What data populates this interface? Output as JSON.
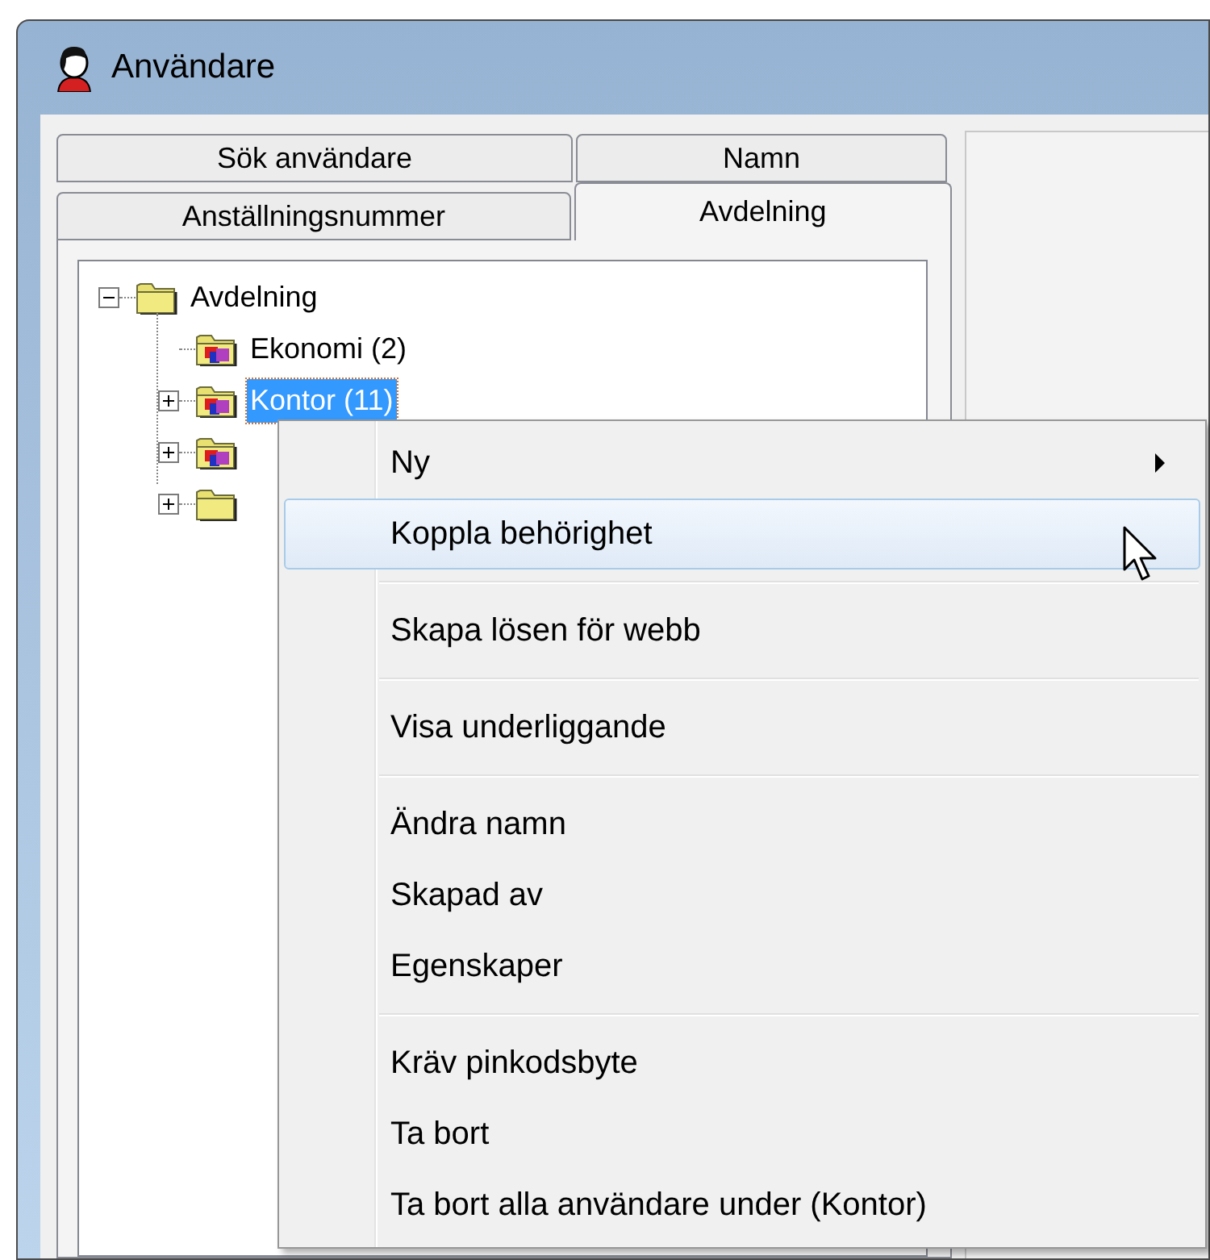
{
  "window": {
    "title": "Användare"
  },
  "tab_rows": [
    [
      {
        "label": "Sök användare",
        "selected": false
      },
      {
        "label": "Namn",
        "selected": false
      }
    ],
    [
      {
        "label": "Anställningsnummer",
        "selected": false
      },
      {
        "label": "Avdelning",
        "selected": true
      }
    ]
  ],
  "tree": {
    "label": "Avdelning",
    "kind": "plain",
    "expandable": true,
    "expanded": true,
    "selected": false,
    "children": [
      {
        "label": "Ekonomi (2)",
        "kind": "members",
        "expandable": false,
        "selected": false
      },
      {
        "label": "Kontor (11)",
        "kind": "members",
        "expandable": true,
        "expanded": false,
        "selected": true
      },
      {
        "kind": "members",
        "expandable": true,
        "expanded": false
      },
      {
        "kind": "plain",
        "expandable": true,
        "expanded": false
      }
    ]
  },
  "context_menu": [
    {
      "kind": "item",
      "label": "Ny",
      "submenu": true,
      "selected": false
    },
    {
      "kind": "item",
      "label": "Koppla behörighet",
      "submenu": false,
      "selected": true
    },
    {
      "kind": "separator"
    },
    {
      "kind": "item",
      "label": "Skapa lösen för webb",
      "submenu": false,
      "selected": false
    },
    {
      "kind": "separator"
    },
    {
      "kind": "item",
      "label": "Visa underliggande",
      "submenu": false,
      "selected": false
    },
    {
      "kind": "separator"
    },
    {
      "kind": "item",
      "label": "Ändra namn",
      "submenu": false,
      "selected": false
    },
    {
      "kind": "item",
      "label": "Skapad av",
      "submenu": false,
      "selected": false
    },
    {
      "kind": "item",
      "label": "Egenskaper",
      "submenu": false,
      "selected": false
    },
    {
      "kind": "separator"
    },
    {
      "kind": "item",
      "label": "Kräv pinkodsbyte",
      "submenu": false,
      "selected": false
    },
    {
      "kind": "item",
      "label": "Ta bort",
      "submenu": false,
      "selected": false
    },
    {
      "kind": "item",
      "label": "Ta bort alla användare under (Kontor)",
      "submenu": false,
      "selected": false
    }
  ]
}
